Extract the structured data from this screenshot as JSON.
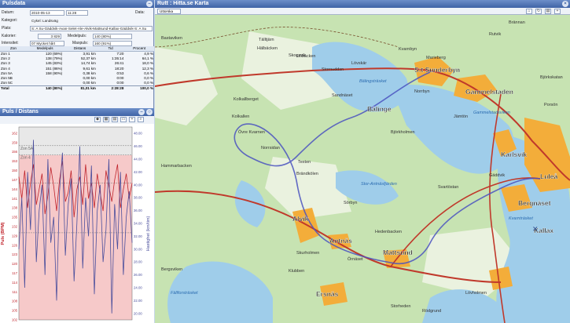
{
  "left_title": "Pulsdata",
  "form": {
    "datum_label": "Datum:",
    "datum_value": "2010-05-13",
    "time_value": "11:28",
    "data_label": "Data:",
    "kategori_label": "Kategori:",
    "kategori_value": "Cykel: Landsväg",
    "plats_label": "Plats:",
    "plats_value": "S: A Su-Gäddvik-Avan-Selet-Ale-Alvik-Mattsund-Kallax-Gäddvik-S: A Su",
    "kalorier_label": "Kalorier:",
    "kalorier_value": "3 829",
    "medelpuls_label": "Medelpuls:",
    "medelpuls_value": "140 (80%)",
    "intensitet_label": "Intensitet:",
    "intensitet_value": "07 Mycket hårt",
    "maxpuls_label": "Maxpuls:",
    "maxpuls_value": "160 (91%)"
  },
  "zones": {
    "headers": [
      "Zon",
      "Medelpuls",
      "Distans",
      "Tid",
      "Procent"
    ],
    "rows": [
      [
        "Zon 1",
        "120 (69%)",
        "3,91 km",
        "7:20",
        "4,9 %"
      ],
      [
        "Zon 2",
        "138 (79%)",
        "52,37 km",
        "1:35:14",
        "64,1 %"
      ],
      [
        "Zon 3",
        "145 (83%)",
        "14,74 km",
        "26:41",
        "18,0 %"
      ],
      [
        "Zon 4",
        "151 (86%)",
        "9,61 km",
        "18:20",
        "12,3 %"
      ],
      [
        "Zon 5A",
        "158 (90%)",
        "0,38 km",
        "0:53",
        "0,6 %"
      ],
      [
        "Zon 5B",
        "",
        "0,00 km",
        "0:00",
        "0,0 %"
      ],
      [
        "Zon 5C",
        "",
        "0,00 km",
        "0:00",
        "0,0 %"
      ]
    ],
    "total": [
      "Total",
      "140 (80%)",
      "81,01 km",
      "2:28:28",
      "100,0 %"
    ]
  },
  "chart_title": "Puls / Distans",
  "chart_data": {
    "type": "line",
    "ylabel": "Puls (BPM)",
    "y2label": "Hastighet (km/tim)",
    "ylim": [
      102,
      164
    ],
    "y2lim": [
      19,
      49
    ],
    "yticks": [
      162,
      159,
      156,
      153,
      150,
      147,
      144,
      141,
      138,
      135,
      132,
      129,
      126,
      123,
      120,
      117,
      114,
      111,
      108,
      105,
      102
    ],
    "y2ticks": [
      48.0,
      46.0,
      44.0,
      42.0,
      40.0,
      38.0,
      36.0,
      34.0,
      32.0,
      30.0,
      28.0,
      26.0,
      24.0,
      22.0,
      20.0
    ],
    "zone_labels": [
      "Zon 5A",
      "Zon 4"
    ],
    "zone_lines": [
      158,
      155,
      146,
      130
    ],
    "series": [
      {
        "axis": "left",
        "color": "#c0242c",
        "values": [
          148,
          141,
          150,
          138,
          146,
          152,
          139,
          144,
          149,
          136,
          142,
          151,
          145,
          137,
          147,
          153,
          140,
          143,
          150,
          135,
          144,
          148,
          139,
          152,
          141,
          146,
          138,
          149,
          143,
          137,
          150,
          145,
          140,
          147,
          152,
          138,
          144,
          149,
          141,
          146
        ]
      },
      {
        "axis": "right",
        "color": "#4a4e9c",
        "values": [
          30,
          38,
          24,
          42,
          33,
          47,
          28,
          36,
          40,
          26,
          44,
          31,
          35,
          22,
          39,
          45,
          29,
          37,
          41,
          25,
          34,
          46,
          27,
          38,
          32,
          43,
          23,
          36,
          40,
          28,
          33,
          44,
          20,
          37,
          30,
          42,
          26,
          35,
          39,
          31
        ]
      }
    ]
  },
  "map_title": "Rutt : Hitta.se Karta",
  "map_dropdown": "Uttorska",
  "map_labels": {
    "towns": [
      "S:t Sunderbyn",
      "Gammelstaden",
      "Luleå",
      "Bergnäset",
      "Karlsvik",
      "Bälinge",
      "Antnäs",
      "Alvik",
      "Mattsund",
      "Ersnäs",
      "Kallax"
    ],
    "places": [
      "Bastaviken",
      "Tälltjärn",
      "Hälbäcken",
      "Lillbäcken",
      "Stornuddsn",
      "Sandnäset",
      "Marieberg",
      "Kvarnbyn",
      "Kolkallberget",
      "Kolkallen",
      "Övre Kvarnen",
      "Norrsidan",
      "Texten",
      "Brändkölen",
      "Skogsvik",
      "Rutvik",
      "Brännan",
      "Porsön",
      "Gäddvik",
      "Svartöstan",
      "Lövskär",
      "Skurholmen",
      "Örnäset",
      "Klubben",
      "Bergsviken",
      "Hedenbacken",
      "Hammarbacken",
      "Rödgrund",
      "Lövholmen",
      "Björkskatan",
      "Storheden",
      "Björkholmen",
      "Norrbyn",
      "Sörbyn",
      "Jämtön"
    ],
    "lakes": [
      "Bälingsträsket",
      "Gammelstadsviken",
      "Fällforsträsket",
      "Kvarnträsket",
      "Stor-Antnäsfjärden"
    ]
  }
}
